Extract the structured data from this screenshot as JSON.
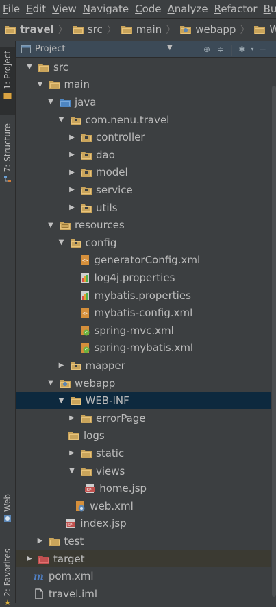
{
  "menu": [
    "File",
    "Edit",
    "View",
    "Navigate",
    "Code",
    "Analyze",
    "Refactor",
    "Buil"
  ],
  "breadcrumb": [
    "travel",
    "src",
    "main",
    "webapp",
    "WEB-INF"
  ],
  "side_tabs": {
    "project": "1: Project",
    "structure": "7: Structure",
    "web": "Web",
    "favorites": "2: Favorites"
  },
  "panel": {
    "title": "Project"
  },
  "tree": [
    {
      "label": "src",
      "depth": 0,
      "arrow": "down",
      "icon": "folder-icon"
    },
    {
      "label": "main",
      "depth": 1,
      "arrow": "down",
      "icon": "folder-icon"
    },
    {
      "label": "java",
      "depth": 2,
      "arrow": "down",
      "icon": "source-folder-icon"
    },
    {
      "label": "com.nenu.travel",
      "depth": 3,
      "arrow": "down",
      "icon": "package-icon"
    },
    {
      "label": "controller",
      "depth": 4,
      "arrow": "right",
      "icon": "package-icon"
    },
    {
      "label": "dao",
      "depth": 4,
      "arrow": "right",
      "icon": "package-icon"
    },
    {
      "label": "model",
      "depth": 4,
      "arrow": "right",
      "icon": "package-icon"
    },
    {
      "label": "service",
      "depth": 4,
      "arrow": "right",
      "icon": "package-icon"
    },
    {
      "label": "utils",
      "depth": 4,
      "arrow": "right",
      "icon": "package-icon"
    },
    {
      "label": "resources",
      "depth": 2,
      "arrow": "down",
      "icon": "resources-folder-icon"
    },
    {
      "label": "config",
      "depth": 3,
      "arrow": "down",
      "icon": "package-icon"
    },
    {
      "label": "generatorConfig.xml",
      "depth": 5,
      "arrow": "none",
      "icon": "xml-file-icon"
    },
    {
      "label": "log4j.properties",
      "depth": 5,
      "arrow": "none",
      "icon": "properties-file-icon"
    },
    {
      "label": "mybatis.properties",
      "depth": 5,
      "arrow": "none",
      "icon": "properties-file-icon"
    },
    {
      "label": "mybatis-config.xml",
      "depth": 5,
      "arrow": "none",
      "icon": "xml-file-icon"
    },
    {
      "label": "spring-mvc.xml",
      "depth": 5,
      "arrow": "none",
      "icon": "spring-xml-icon"
    },
    {
      "label": "spring-mybatis.xml",
      "depth": 5,
      "arrow": "none",
      "icon": "spring-xml-icon"
    },
    {
      "label": "mapper",
      "depth": 3,
      "arrow": "right",
      "icon": "package-icon"
    },
    {
      "label": "webapp",
      "depth": 2,
      "arrow": "down",
      "icon": "web-folder-icon"
    },
    {
      "label": "WEB-INF",
      "depth": 3,
      "arrow": "down",
      "icon": "folder-icon",
      "selected": true
    },
    {
      "label": "errorPage",
      "depth": 4,
      "arrow": "right",
      "icon": "folder-icon"
    },
    {
      "label": "logs",
      "depth": 4,
      "arrow": "none",
      "icon": "folder-icon"
    },
    {
      "label": "static",
      "depth": 4,
      "arrow": "right",
      "icon": "folder-icon"
    },
    {
      "label": "views",
      "depth": 4,
      "arrow": "down",
      "icon": "folder-icon"
    },
    {
      "label": "home.jsp",
      "depth": 5.5,
      "arrow": "none",
      "icon": "jsp-file-icon"
    },
    {
      "label": "web.xml",
      "depth": 4.6,
      "arrow": "none",
      "icon": "web-xml-icon"
    },
    {
      "label": "index.jsp",
      "depth": 3.7,
      "arrow": "none",
      "icon": "jsp-file-icon"
    },
    {
      "label": "test",
      "depth": 1,
      "arrow": "right",
      "icon": "folder-icon"
    },
    {
      "label": "target",
      "depth": 0,
      "arrow": "right",
      "icon": "excluded-folder-icon",
      "excluded": true
    },
    {
      "label": "pom.xml",
      "depth": 0.7,
      "arrow": "none",
      "icon": "maven-icon"
    },
    {
      "label": "travel.iml",
      "depth": 0.7,
      "arrow": "none",
      "icon": "iml-file-icon"
    }
  ]
}
